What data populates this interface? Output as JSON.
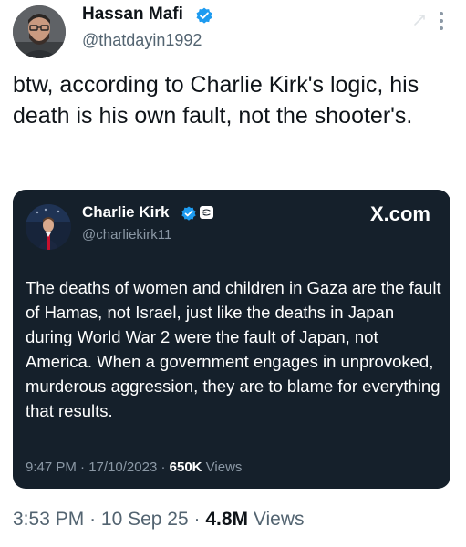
{
  "tweet": {
    "author": {
      "display_name": "Hassan Mafi",
      "handle": "@thatdayin1992",
      "verified": true
    },
    "text": "btw, according to Charlie Kirk's logic, his death is his own fault, not the shooter's.",
    "quoted": {
      "author": {
        "display_name": "Charlie Kirk",
        "handle": "@charliekirk11",
        "verified": true
      },
      "source": "X.com",
      "text": "The deaths of women and children in Gaza are the fault of Hamas, not Israel, just like the deaths in Japan during World War 2 were the fault of Japan, not America. When a government engages in unprovoked, murderous aggression, they are to blame for everything that results.",
      "time": "9:47 PM",
      "date": "17/10/2023",
      "views_count": "650K",
      "views_label": "Views"
    },
    "time": "3:53 PM",
    "date": "10 Sep 25",
    "views_count": "4.8M",
    "views_label": "Views",
    "separator": "·"
  },
  "colors": {
    "verified_blue": "#1d9bf0",
    "quote_background": "#15202b",
    "secondary_text": "#536471"
  },
  "icons": [
    "verified-badge-icon",
    "grok-icon",
    "more-options-icon",
    "affiliate-badge-icon"
  ]
}
